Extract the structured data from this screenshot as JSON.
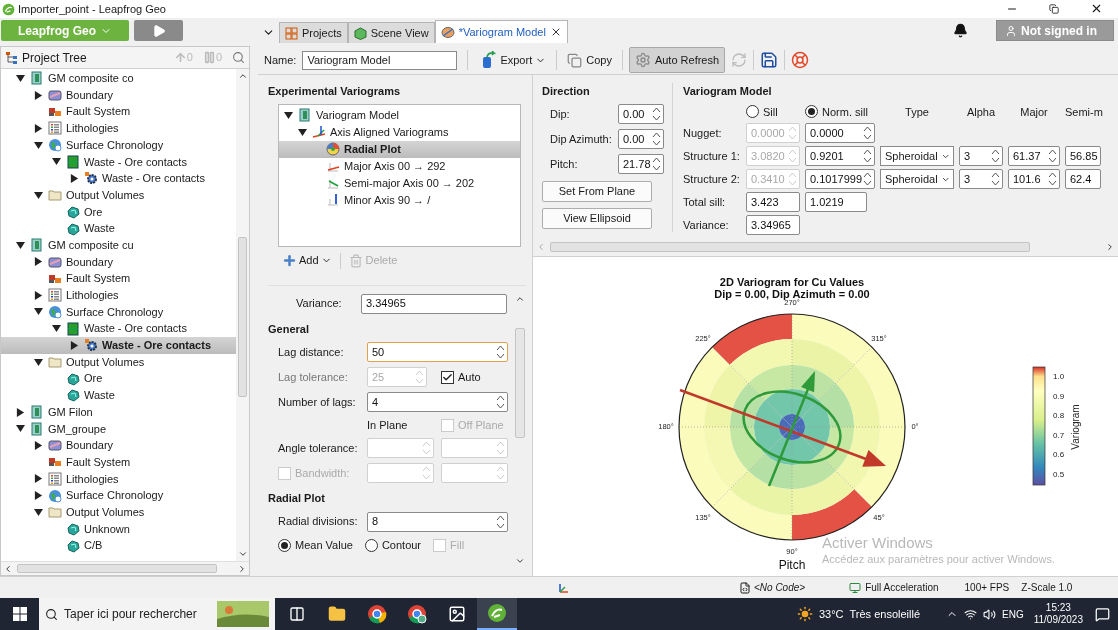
{
  "window": {
    "title": "Importer_point - Leapfrog Geo"
  },
  "app_menu": {
    "label": "Leapfrog Geo"
  },
  "tabs": [
    {
      "label": "Projects",
      "selected": false,
      "kind": "projects"
    },
    {
      "label": "Scene View",
      "selected": false,
      "kind": "scene"
    },
    {
      "label": "*Variogram Model",
      "selected": true,
      "kind": "variogram"
    }
  ],
  "account": {
    "label": "Not signed in"
  },
  "project_tree": {
    "title": "Project Tree",
    "up_count": "0",
    "pause_count": "0",
    "items": [
      {
        "label": "GM composite co",
        "kind": "model",
        "expanded": true,
        "selected": false,
        "children": [
          {
            "label": "Boundary",
            "kind": "boundary",
            "expanded": false,
            "selected": false
          },
          {
            "label": "Fault System",
            "kind": "fault",
            "selected": false
          },
          {
            "label": "Lithologies",
            "kind": "lithology",
            "expanded": false,
            "selected": false
          },
          {
            "label": "Surface Chronology",
            "kind": "chronology",
            "expanded": true,
            "selected": false,
            "children": [
              {
                "label": "Waste - Ore contacts",
                "kind": "contacts",
                "expanded": true,
                "selected": false,
                "children": [
                  {
                    "label": "Waste - Ore contacts",
                    "kind": "surface",
                    "expanded": false,
                    "selected": false
                  }
                ]
              }
            ]
          },
          {
            "label": "Output Volumes",
            "kind": "folder",
            "expanded": true,
            "selected": false,
            "children": [
              {
                "label": "Ore",
                "kind": "volume",
                "selected": false
              },
              {
                "label": "Waste",
                "kind": "volume",
                "selected": false
              }
            ]
          }
        ]
      },
      {
        "label": "GM composite cu",
        "kind": "model",
        "expanded": true,
        "selected": false,
        "children": [
          {
            "label": "Boundary",
            "kind": "boundary",
            "expanded": false,
            "selected": false
          },
          {
            "label": "Fault System",
            "kind": "fault",
            "selected": false
          },
          {
            "label": "Lithologies",
            "kind": "lithology",
            "expanded": false,
            "selected": false
          },
          {
            "label": "Surface Chronology",
            "kind": "chronology",
            "expanded": true,
            "selected": false,
            "children": [
              {
                "label": "Waste - Ore contacts",
                "kind": "contacts",
                "expanded": true,
                "selected": false,
                "children": [
                  {
                    "label": "Waste - Ore contacts",
                    "kind": "surface",
                    "expanded": false,
                    "selected": true
                  }
                ]
              }
            ]
          },
          {
            "label": "Output Volumes",
            "kind": "folder",
            "expanded": true,
            "selected": false,
            "children": [
              {
                "label": "Ore",
                "kind": "volume",
                "selected": false
              },
              {
                "label": "Waste",
                "kind": "volume",
                "selected": false
              }
            ]
          }
        ]
      },
      {
        "label": "GM Filon",
        "kind": "model",
        "expanded": false,
        "selected": false
      },
      {
        "label": "GM_groupe",
        "kind": "model",
        "expanded": true,
        "selected": false,
        "children": [
          {
            "label": "Boundary",
            "kind": "boundary",
            "expanded": false,
            "selected": false
          },
          {
            "label": "Fault System",
            "kind": "fault",
            "selected": false
          },
          {
            "label": "Lithologies",
            "kind": "lithology",
            "expanded": false,
            "selected": false
          },
          {
            "label": "Surface Chronology",
            "kind": "chronology",
            "expanded": false,
            "selected": false
          },
          {
            "label": "Output Volumes",
            "kind": "folder",
            "expanded": true,
            "selected": false,
            "children": [
              {
                "label": "Unknown",
                "kind": "volume",
                "selected": false
              },
              {
                "label": "C/B",
                "kind": "volume",
                "selected": false
              }
            ]
          }
        ]
      }
    ]
  },
  "toolbar": {
    "name_label": "Name:",
    "name_value": "Variogram Model",
    "export": "Export",
    "copy": "Copy",
    "auto_refresh": {
      "label": "Auto Refresh",
      "on": true
    }
  },
  "experimental_variograms": {
    "title": "Experimental Variograms",
    "add": "Add",
    "delete": "Delete",
    "items": [
      {
        "label": "Variogram Model",
        "kind": "model",
        "expanded": true,
        "selected": false,
        "children": [
          {
            "label": "Axis Aligned Variograms",
            "kind": "axes",
            "expanded": true,
            "selected": false,
            "children": [
              {
                "label": "Radial Plot",
                "kind": "radial",
                "selected": true
              },
              {
                "label": "Major Axis 00 → 292",
                "kind": "major",
                "selected": false
              },
              {
                "label": "Semi-major Axis 00 → 202",
                "kind": "semi",
                "selected": false
              },
              {
                "label": "Minor Axis 90 → /",
                "kind": "minor",
                "selected": false
              }
            ]
          }
        ]
      }
    ]
  },
  "variance": {
    "label": "Variance:",
    "value": "3.34965"
  },
  "general": {
    "title": "General",
    "fields": [
      {
        "label": "Lag distance:",
        "value": "50",
        "focused": true,
        "disabled": false
      },
      {
        "label": "Lag tolerance:",
        "value": "25",
        "focused": false,
        "disabled": true,
        "auto": {
          "label": "Auto",
          "checked": true
        }
      },
      {
        "label": "Number of lags:",
        "value": "4",
        "focused": false,
        "disabled": false
      }
    ],
    "in_plane": "In Plane",
    "off_plane": {
      "label": "Off Plane",
      "checked": false,
      "disabled": true
    },
    "angle_tolerance": {
      "label": "Angle tolerance:",
      "disabled": true
    },
    "bandwidth": {
      "label": "Bandwidth:",
      "checked": false,
      "disabled": true
    }
  },
  "radial_plot_settings": {
    "title": "Radial Plot",
    "divisions": {
      "label": "Radial divisions:",
      "value": "8"
    },
    "modes": [
      {
        "label": "Mean Value",
        "selected": true
      },
      {
        "label": "Contour",
        "selected": false
      }
    ],
    "fill": {
      "label": "Fill",
      "checked": false,
      "disabled": true
    }
  },
  "direction": {
    "title": "Direction",
    "fields": [
      {
        "label": "Dip:",
        "value": "0.00"
      },
      {
        "label": "Dip Azimuth:",
        "value": "0.00"
      },
      {
        "label": "Pitch:",
        "value": "21.78"
      }
    ],
    "buttons": [
      "Set From Plane",
      "View Ellipsoid"
    ]
  },
  "variogram_model": {
    "title": "Variogram Model",
    "sill_modes": [
      {
        "label": "Sill",
        "selected": false
      },
      {
        "label": "Norm. sill",
        "selected": true
      }
    ],
    "columns": [
      "Type",
      "Alpha",
      "Major",
      "Semi-m"
    ],
    "rows": [
      {
        "label": "Nugget:",
        "sill": "0.0000",
        "norm_sill": "0.0000"
      },
      {
        "label": "Structure 1:",
        "sill": "3.0820",
        "norm_sill": "0.9201",
        "type": "Spheroidal",
        "alpha": "3",
        "major": "61.37",
        "semi_major": "56.85"
      },
      {
        "label": "Structure 2:",
        "sill": "0.3410",
        "norm_sill": "0.1017999",
        "type": "Spheroidal",
        "alpha": "3",
        "major": "101.6",
        "semi_major": "62.4"
      }
    ],
    "total_sill": {
      "label": "Total sill:",
      "sill": "3.423",
      "norm_sill": "1.0219"
    },
    "variance": {
      "label": "Variance:",
      "value": "3.34965"
    }
  },
  "chart": {
    "title": "2D Variogram for Cu Values",
    "subtitle": "Dip = 0.00, Dip Azimuth = 0.00",
    "angle_labels": [
      "0°",
      "45°",
      "90°",
      "135°",
      "180°",
      "225°",
      "270°",
      "315°"
    ],
    "axis_label": "Pitch",
    "colorbar": {
      "label": "Variogram",
      "ticks": [
        "1.0",
        "0.9",
        "0.8",
        "0.7",
        "0.6",
        "0.5"
      ]
    }
  },
  "activation_notice": {
    "title": "Activer Windows",
    "message": "Accédez aux paramètres pour activer Windows."
  },
  "status_bar": {
    "code": "<No Code>",
    "acceleration": "Full Acceleration",
    "fps": "100+ FPS",
    "z_scale": "Z-Scale 1.0"
  },
  "taskbar": {
    "search": "Taper ici pour rechercher",
    "apps": [
      {
        "kind": "task-view",
        "selected": false
      },
      {
        "kind": "explorer",
        "selected": false
      },
      {
        "kind": "chrome",
        "selected": false
      },
      {
        "kind": "chrome-profile",
        "selected": false
      },
      {
        "kind": "photos",
        "selected": false
      },
      {
        "kind": "leapfrog",
        "selected": true
      }
    ],
    "weather": {
      "temperature": "33°C",
      "condition": "Très ensoleillé"
    },
    "language": "ENG",
    "time": "15:23",
    "date": "11/09/2023"
  }
}
